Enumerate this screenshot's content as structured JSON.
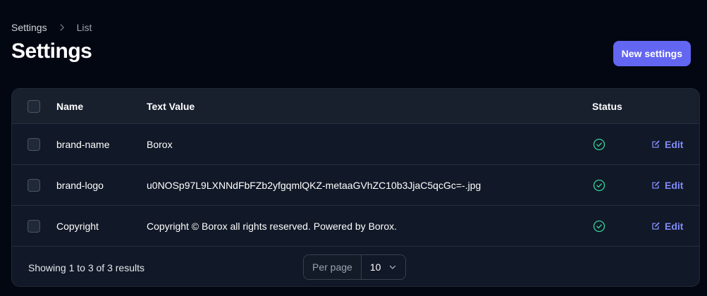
{
  "breadcrumb": {
    "items": [
      "Settings",
      "List"
    ]
  },
  "page_title": "Settings",
  "actions": {
    "new_label": "New settings"
  },
  "table": {
    "columns": [
      "Name",
      "Text Value",
      "Status"
    ],
    "rows": [
      {
        "name": "brand-name",
        "value": "Borox",
        "status": "active",
        "edit_label": "Edit"
      },
      {
        "name": "brand-logo",
        "value": "u0NOSp97L9LXNNdFbFZb2yfgqmlQKZ-metaaGVhZC10b3JjaC5qcGc=-.jpg",
        "status": "active",
        "edit_label": "Edit"
      },
      {
        "name": "Copyright",
        "value": "Copyright © Borox all rights reserved. Powered by Borox.",
        "status": "active",
        "edit_label": "Edit"
      }
    ]
  },
  "pagination": {
    "summary": "Showing 1 to 3 of 3 results",
    "per_page_label": "Per page",
    "per_page_value": "10"
  },
  "icons": {
    "breadcrumb_separator": "chevron-right-icon",
    "status": "check-circle-icon",
    "edit": "pencil-square-icon",
    "select": "chevron-down-icon"
  },
  "colors": {
    "background": "#030712",
    "card": "#111827",
    "accent": "#6366f1",
    "link": "#818cf8",
    "success": "#34d399"
  }
}
